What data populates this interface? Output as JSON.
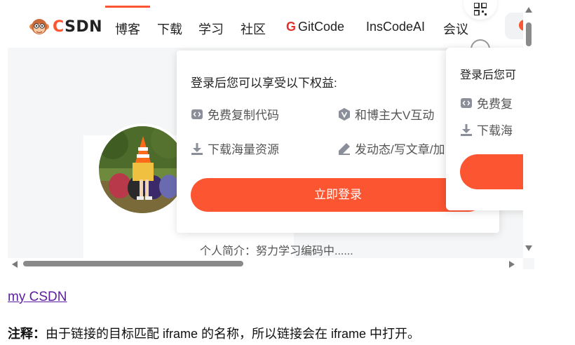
{
  "iframe": {
    "brand": {
      "logo_text_c": "C",
      "logo_text_rest": "SDN"
    },
    "nav": [
      {
        "label": "博客"
      },
      {
        "label": "下载"
      },
      {
        "label": "学习"
      },
      {
        "label": "社区"
      },
      {
        "label": "GitCode"
      },
      {
        "label": "InsCodeAI"
      },
      {
        "label": "会议"
      }
    ],
    "profile": {
      "bio": "个人简介：努力学习编码中......"
    },
    "login_popup": {
      "title": "登录后您可以享受以下权益:",
      "benefits": [
        {
          "label": "免费复制代码",
          "icon": "code-copy-icon"
        },
        {
          "label": "和博主大V互动",
          "icon": "v-badge-icon"
        },
        {
          "label": "下载海量资源",
          "icon": "download-icon"
        },
        {
          "label": "发动态/写文章/加",
          "icon": "pen-icon"
        }
      ],
      "button": "立即登录"
    },
    "login_popup_2": {
      "title": "登录后您可",
      "benefits": [
        {
          "label": "免费复",
          "icon": "code-copy-icon"
        },
        {
          "label": "下载海",
          "icon": "download-icon"
        }
      ]
    }
  },
  "link": {
    "text": "my CSDN"
  },
  "note": {
    "label": "注释：",
    "text": "由于链接的目标匹配 iframe 的名称，所以链接会在 iframe 中打开。"
  },
  "colors": {
    "accent": "#fc5531",
    "link": "#5b1da1"
  }
}
